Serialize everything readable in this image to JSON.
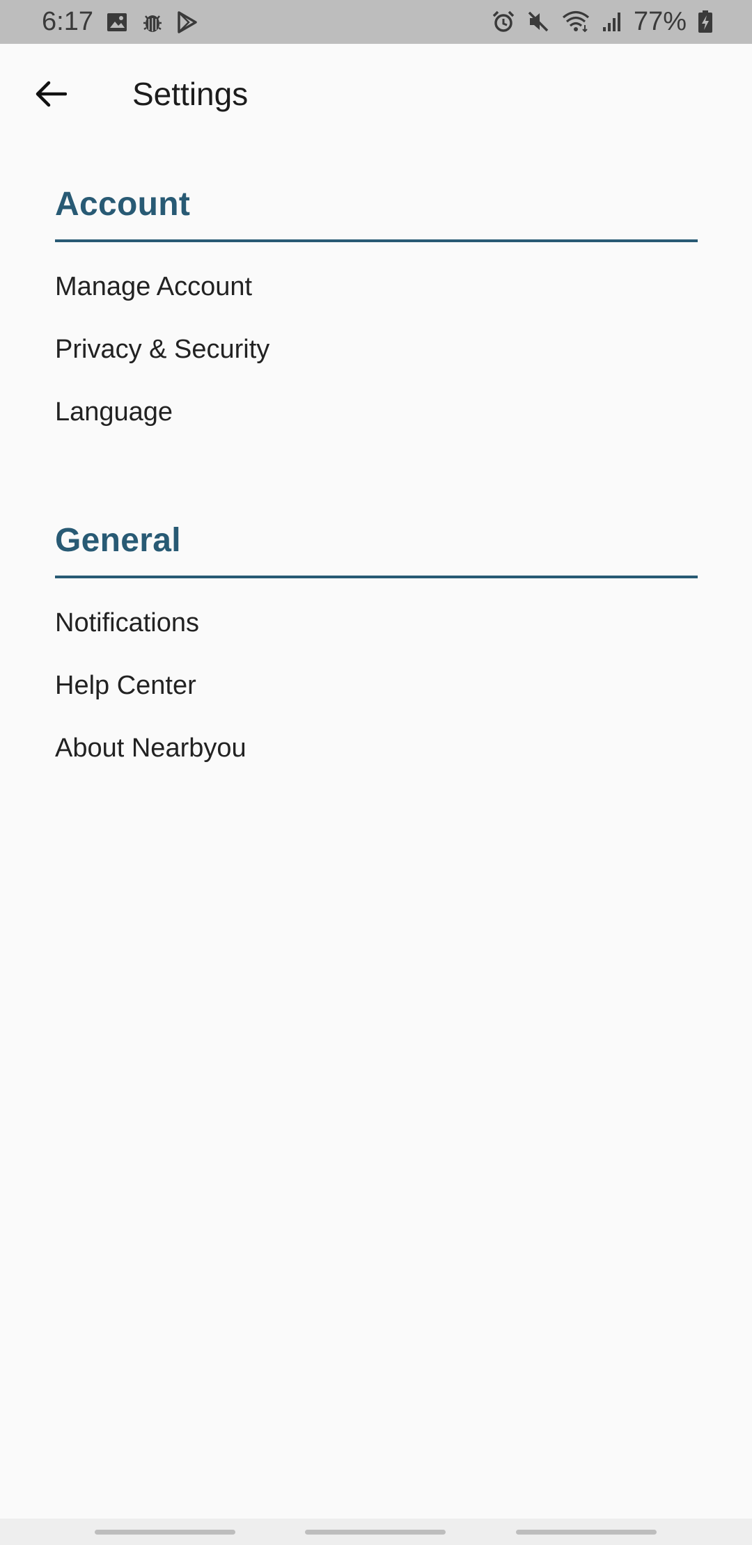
{
  "status_bar": {
    "time": "6:17",
    "battery_percent": "77%",
    "left_icons": [
      "image-icon",
      "bug-icon",
      "play-store-icon"
    ],
    "right_icons": [
      "alarm-icon",
      "mute-icon",
      "wifi-icon",
      "signal-icon",
      "battery-charging-icon"
    ]
  },
  "toolbar": {
    "back_icon": "arrow-back-icon",
    "title": "Settings"
  },
  "sections": [
    {
      "header": "Account",
      "items": [
        {
          "label": "Manage Account"
        },
        {
          "label": "Privacy & Security"
        },
        {
          "label": "Language"
        }
      ]
    },
    {
      "header": "General",
      "items": [
        {
          "label": "Notifications"
        },
        {
          "label": "Help Center"
        },
        {
          "label": "About Nearbyou"
        }
      ]
    }
  ],
  "colors": {
    "accent": "#285a74",
    "status_bar_bg": "#bdbdbd",
    "background": "#fafafa",
    "text": "#222222"
  }
}
